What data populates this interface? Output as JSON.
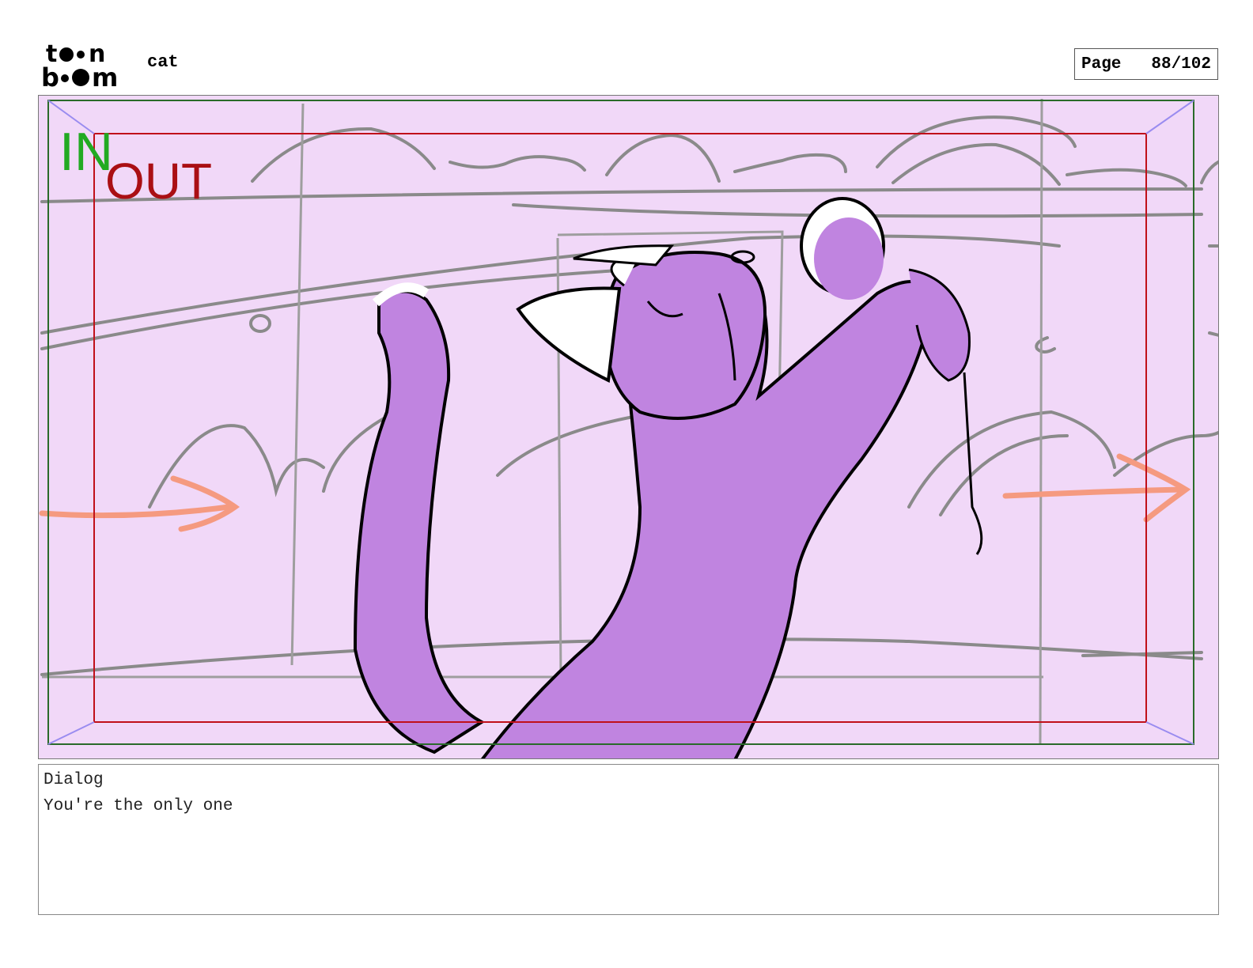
{
  "header": {
    "logo_icon": "toon-boom-logo",
    "logo_line1": "toon",
    "logo_line2": "boom",
    "project_name": "cat",
    "page_label": "Page",
    "page_number": "88/102"
  },
  "panel": {
    "in_marker": "IN",
    "out_marker": "OUT",
    "colors": {
      "background": "#f1d8f8",
      "cat_fill": "#c084e0",
      "sketch": "#8a8a8a",
      "arrow": "#f59a80",
      "in_color": "#22aa22",
      "out_color": "#aa0f14",
      "safe_frame": "#c0101a",
      "camera_frame": "#2a6a2a"
    }
  },
  "dialog": {
    "label": "Dialog",
    "text": "You're the only one"
  }
}
